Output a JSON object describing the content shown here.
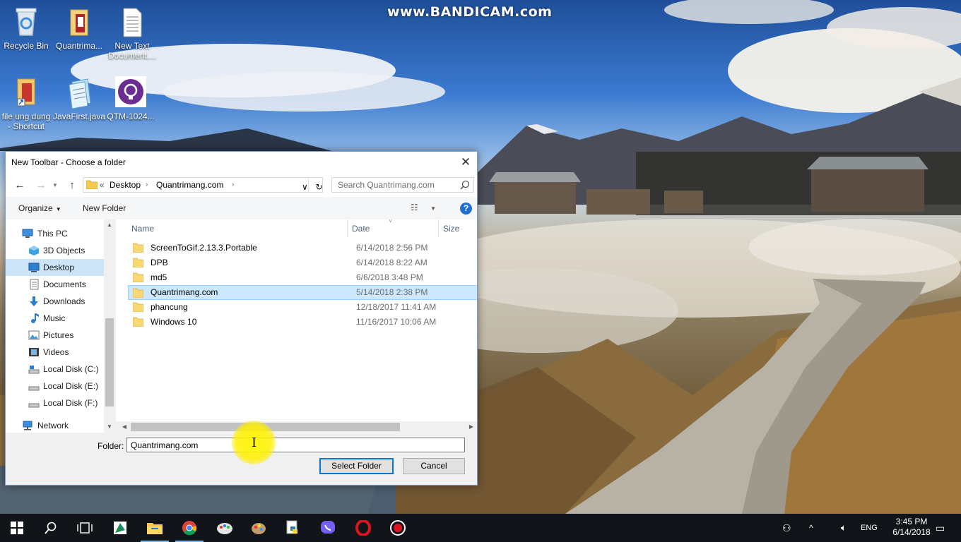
{
  "watermark": "www.BANDICAM.com",
  "desktop_icons": [
    {
      "label": "Recycle Bin"
    },
    {
      "label": "Quantrima..."
    },
    {
      "label": "New Text Document...."
    },
    {
      "label": "file ung dung - Shortcut"
    },
    {
      "label": "JavaFirst.java"
    },
    {
      "label": "QTM-1024..."
    }
  ],
  "dialog": {
    "title": "New Toolbar - Choose a folder",
    "address": {
      "overflow": "«",
      "parts": [
        "Desktop",
        "Quantrimang.com"
      ]
    },
    "search_placeholder": "Search Quantrimang.com",
    "organize": "Organize",
    "new_folder": "New Folder",
    "nav_items": [
      {
        "label": "This PC",
        "icon": "this-pc-icon"
      },
      {
        "label": "3D Objects",
        "icon": "3d-objects-icon"
      },
      {
        "label": "Desktop",
        "icon": "desktop-icon",
        "selected": true
      },
      {
        "label": "Documents",
        "icon": "documents-icon"
      },
      {
        "label": "Downloads",
        "icon": "downloads-icon"
      },
      {
        "label": "Music",
        "icon": "music-icon"
      },
      {
        "label": "Pictures",
        "icon": "pictures-icon"
      },
      {
        "label": "Videos",
        "icon": "videos-icon"
      },
      {
        "label": "Local Disk (C:)",
        "icon": "drive-icon"
      },
      {
        "label": "Local Disk (E:)",
        "icon": "drive-icon"
      },
      {
        "label": "Local Disk (F:)",
        "icon": "drive-icon"
      },
      {
        "label": "Network",
        "icon": "network-icon"
      }
    ],
    "columns": {
      "name": "Name",
      "date": "Date",
      "size": "Size"
    },
    "files": [
      {
        "name": "ScreenToGif.2.13.3.Portable",
        "date": "6/14/2018 2:56 PM"
      },
      {
        "name": "DPB",
        "date": "6/14/2018 8:22 AM"
      },
      {
        "name": "md5",
        "date": "6/6/2018 3:48 PM"
      },
      {
        "name": "Quantrimang.com",
        "date": "5/14/2018 2:38 PM",
        "selected": true
      },
      {
        "name": "phancung",
        "date": "12/18/2017 11:41 AM"
      },
      {
        "name": "Windows 10",
        "date": "11/16/2017 10:06 AM"
      }
    ],
    "folder_label": "Folder:",
    "folder_value": "Quantrimang.com",
    "select_button": "Select Folder",
    "cancel_button": "Cancel"
  },
  "taskbar": {
    "language": "ENG",
    "time": "3:45 PM",
    "date": "6/14/2018"
  },
  "colors": {
    "accent": "#0078d7",
    "selection": "#cce8ff",
    "taskbar": "#111418"
  }
}
